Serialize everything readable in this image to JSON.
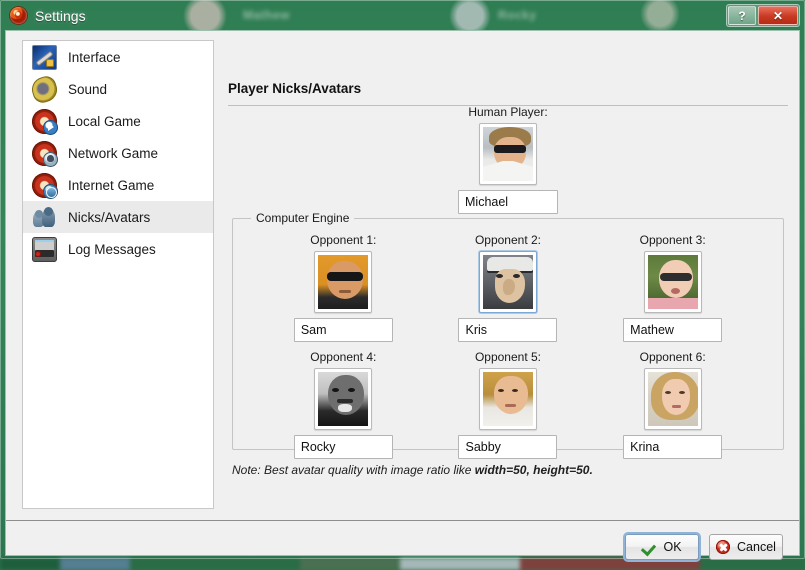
{
  "window": {
    "title": "Settings",
    "app_icon": "app-logo-icon",
    "help_button": "?",
    "close_button": "✕",
    "backdrop_labels": [
      "Mathew",
      "Rocky"
    ]
  },
  "sidebar": {
    "items": [
      {
        "label": "Interface",
        "icon": "interface-icon",
        "selected": false
      },
      {
        "label": "Sound",
        "icon": "sound-icon",
        "selected": false
      },
      {
        "label": "Local Game",
        "icon": "local-game-icon",
        "selected": false
      },
      {
        "label": "Network Game",
        "icon": "network-game-icon",
        "selected": false
      },
      {
        "label": "Internet Game",
        "icon": "internet-game-icon",
        "selected": false
      },
      {
        "label": "Nicks/Avatars",
        "icon": "nicks-avatars-icon",
        "selected": true
      },
      {
        "label": "Log Messages",
        "icon": "log-messages-icon",
        "selected": false
      }
    ]
  },
  "main": {
    "page_title": "Player Nicks/Avatars",
    "human": {
      "caption": "Human Player:",
      "nick": "Michael",
      "avatar": "avatar-michael",
      "focused": false
    },
    "group": {
      "legend": "Computer Engine",
      "opponents": [
        {
          "caption": "Opponent 1:",
          "nick": "Sam",
          "avatar": "avatar-sam",
          "focused": false
        },
        {
          "caption": "Opponent 2:",
          "nick": "Kris",
          "avatar": "avatar-kris",
          "focused": true
        },
        {
          "caption": "Opponent 3:",
          "nick": "Mathew",
          "avatar": "avatar-mathew",
          "focused": false
        },
        {
          "caption": "Opponent 4:",
          "nick": "Rocky",
          "avatar": "avatar-rocky",
          "focused": false
        },
        {
          "caption": "Opponent 5:",
          "nick": "Sabby",
          "avatar": "avatar-sabby",
          "focused": false
        },
        {
          "caption": "Opponent 6:",
          "nick": "Krina",
          "avatar": "avatar-krina",
          "focused": false
        }
      ]
    },
    "note_prefix": "Note: Best avatar quality with image ratio like ",
    "note_emphasis": "width=50, height=50."
  },
  "footer": {
    "ok_label": "OK",
    "cancel_label": "Cancel"
  },
  "colors": {
    "titlebar_green": "#2f7d53",
    "close_red": "#c93a22",
    "focus_blue": "#7aa9d6",
    "selection_gray": "#eaeaea",
    "panel_gray": "#f0f0f0"
  }
}
